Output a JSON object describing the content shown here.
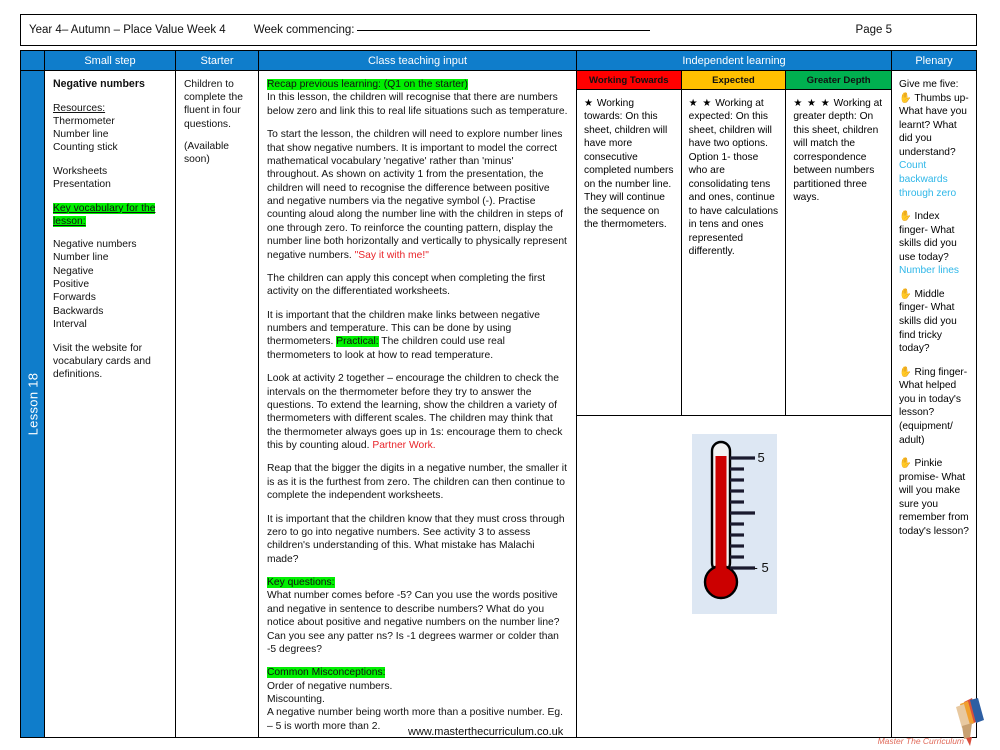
{
  "header": {
    "title": "Year 4– Autumn – Place Value Week 4",
    "week_commencing_label": "Week commencing:",
    "page_label": "Page 5"
  },
  "columns": {
    "small_step": "Small step",
    "starter": "Starter",
    "class_teaching_input": "Class teaching input",
    "independent_learning": "Independent learning",
    "plenary": "Plenary"
  },
  "lesson_spine": "Lesson 18",
  "small_step": {
    "title": "Negative numbers",
    "resources_label": "Resources:",
    "resources": [
      "Thermometer",
      "Number line",
      "Counting stick"
    ],
    "materials": [
      "Worksheets",
      "Presentation"
    ],
    "key_vocab_heading": "Key vocabulary for the lesson:",
    "vocab": [
      "Negative numbers",
      "Number line",
      "Negative",
      "Positive",
      "Forwards",
      "Backwards",
      "Interval"
    ],
    "footer_note": "Visit the website for vocabulary cards and definitions."
  },
  "starter": {
    "text": "Children to complete the fluent in four questions.",
    "note": "(Available soon)"
  },
  "class_teaching": {
    "recap_heading": "Recap previous learning: (Q1 on the starter)",
    "recap_text": "In this lesson, the children will recognise that there are numbers below zero and link this to real life situations such as temperature.",
    "para2": "To start the lesson, the children will need to explore number lines that show negative numbers. It is important to model the correct mathematical vocabulary 'negative' rather than 'minus' throughout. As shown on activity 1 from the presentation, the children will need to recognise the difference between positive and negative numbers via the negative symbol (-). Practise counting aloud along the number line with the children in steps of one through zero. To reinforce the counting pattern, display the number line both horizontally and vertically to physically represent negative numbers.",
    "say_it": "\"Say it with me!\"",
    "para3": "The children can apply this concept when completing the first activity on the differentiated worksheets.",
    "para4_a": "It is important that the children make links between negative numbers and temperature. This can be done by using thermometers. ",
    "practical_label": "Practical:",
    "para4_b": " The children could use real thermometers to look at how to read temperature.",
    "para5_a": "Look at activity 2 together – encourage the children to check the intervals on the thermometer before they try to answer the questions. To extend the learning, show the children a variety of thermometers with different scales. The children may think that the thermometer always goes up in 1s: encourage them to check this by counting aloud. ",
    "partner_work": "Partner Work.",
    "para6": "Reap that the bigger the digits in a negative number, the smaller it is as it is the furthest from zero. The children can then continue to complete the independent worksheets.",
    "para7": "It is important that the children know that they must cross through zero to go into negative numbers. See activity 3 to assess children's understanding of this. What mistake has Malachi made?",
    "key_questions_heading": "Key questions:",
    "key_questions_text": "What number comes before -5? Can you use the words positive and negative in sentence to describe numbers? What do you notice about positive and negative numbers on the number line? Can you see any patter ns? Is -1 degrees warmer or colder than -5 degrees?",
    "misconceptions_heading": "Common Misconceptions:",
    "misconceptions": [
      "Order of negative numbers.",
      "Miscounting.",
      "A negative number being worth more than a positive number. Eg.  – 5 is worth more than 2."
    ]
  },
  "independent": {
    "levels": [
      {
        "header": "Working Towards",
        "header_color": "#ff0000",
        "stars": "★",
        "lead": "Working towards:",
        "body": "On this sheet, children will have more consecutive completed numbers on the number line. They will continue the sequence on the thermometers."
      },
      {
        "header": "Expected",
        "header_color": "#ffc000",
        "stars": "★ ★",
        "lead": "Working at expected:",
        "body": "On this sheet, children will have two options. Option 1- those who are consolidating tens and ones, continue to have calculations in tens and ones represented differently."
      },
      {
        "header": "Greater Depth",
        "header_color": "#00b050",
        "stars": "★ ★ ★",
        "lead": "Working at greater depth:",
        "body": "On this sheet, children will match the correspondence between numbers partitioned three ways."
      }
    ],
    "thermometer": {
      "top_label": "5",
      "bottom_label": "- 5",
      "liquid_color": "#cc0000",
      "background_color": "#dde7f3"
    }
  },
  "plenary": {
    "intro": "Give me five:",
    "items": [
      {
        "icon": "hand-icon",
        "text": "Thumbs up- What have you learnt? What did you understand?",
        "answer": "Count backwards through zero"
      },
      {
        "icon": "hand-icon",
        "text": "Index finger- What skills did you use today?",
        "answer": "Number lines"
      },
      {
        "icon": "hand-icon",
        "text": "Middle finger- What skills did you find tricky today?",
        "answer": ""
      },
      {
        "icon": "hand-icon",
        "text": "Ring finger- What helped you in today's lesson? (equipment/ adult)",
        "answer": ""
      },
      {
        "icon": "hand-icon",
        "text": "Pinkie promise- What will you make sure you remember from today's lesson?",
        "answer": ""
      }
    ]
  },
  "footer": {
    "url": "www.masterthecurriculum.co.uk",
    "logo_text": "Master The Curriculum"
  },
  "theme": {
    "header_blue": "#0f7dcb",
    "highlight_green": "#00f000",
    "red_text": "#e8242a",
    "cyan_text": "#2fb7e8"
  }
}
